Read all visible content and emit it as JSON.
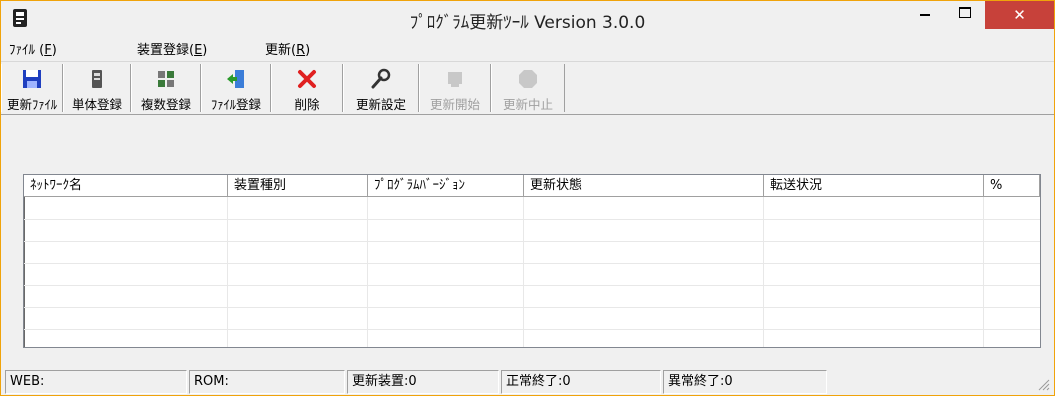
{
  "window": {
    "title": "ﾌﾟﾛｸﾞﾗﾑ更新ﾂｰﾙ Version 3.0.0",
    "close_symbol": "✕"
  },
  "menu": {
    "items": [
      {
        "label": "ﾌｧｲﾙ (",
        "accel": "F",
        "suffix": ")"
      },
      {
        "label": "装置登録(",
        "accel": "E",
        "suffix": ")"
      },
      {
        "label": "更新(",
        "accel": "R",
        "suffix": ")"
      }
    ]
  },
  "toolbar": {
    "buttons": [
      {
        "label": "更新ﾌｧｲﾙ",
        "icon": "floppy-save-icon",
        "enabled": true
      },
      {
        "label": "単体登録",
        "icon": "single-device-icon",
        "enabled": true
      },
      {
        "label": "複数登録",
        "icon": "multiple-devices-icon",
        "enabled": true
      },
      {
        "label": "ﾌｧｲﾙ登録",
        "icon": "file-import-icon",
        "enabled": true
      },
      {
        "label": "削除",
        "icon": "delete-x-icon",
        "enabled": true
      },
      {
        "label": "更新設定",
        "icon": "wrench-settings-icon",
        "enabled": true
      },
      {
        "label": "更新開始",
        "icon": "start-update-icon",
        "enabled": false
      },
      {
        "label": "更新中止",
        "icon": "stop-sign-icon",
        "enabled": false
      }
    ]
  },
  "list": {
    "columns": [
      "ﾈｯﾄﾜｰｸ名",
      "装置種別",
      "ﾌﾟﾛｸﾞﾗﾑﾊﾞｰｼﾞｮﾝ",
      "更新状態",
      "転送状況",
      "%"
    ],
    "rows": []
  },
  "status": {
    "web": "WEB:",
    "rom": "ROM:",
    "updating": "更新装置:0",
    "success": "正常終了:0",
    "failed": "異常終了:0"
  },
  "colors": {
    "close_button": "#c7413a",
    "window_border": "#f0a30a",
    "delete_icon": "#e02020",
    "save_icon": "#1f3fbf"
  }
}
